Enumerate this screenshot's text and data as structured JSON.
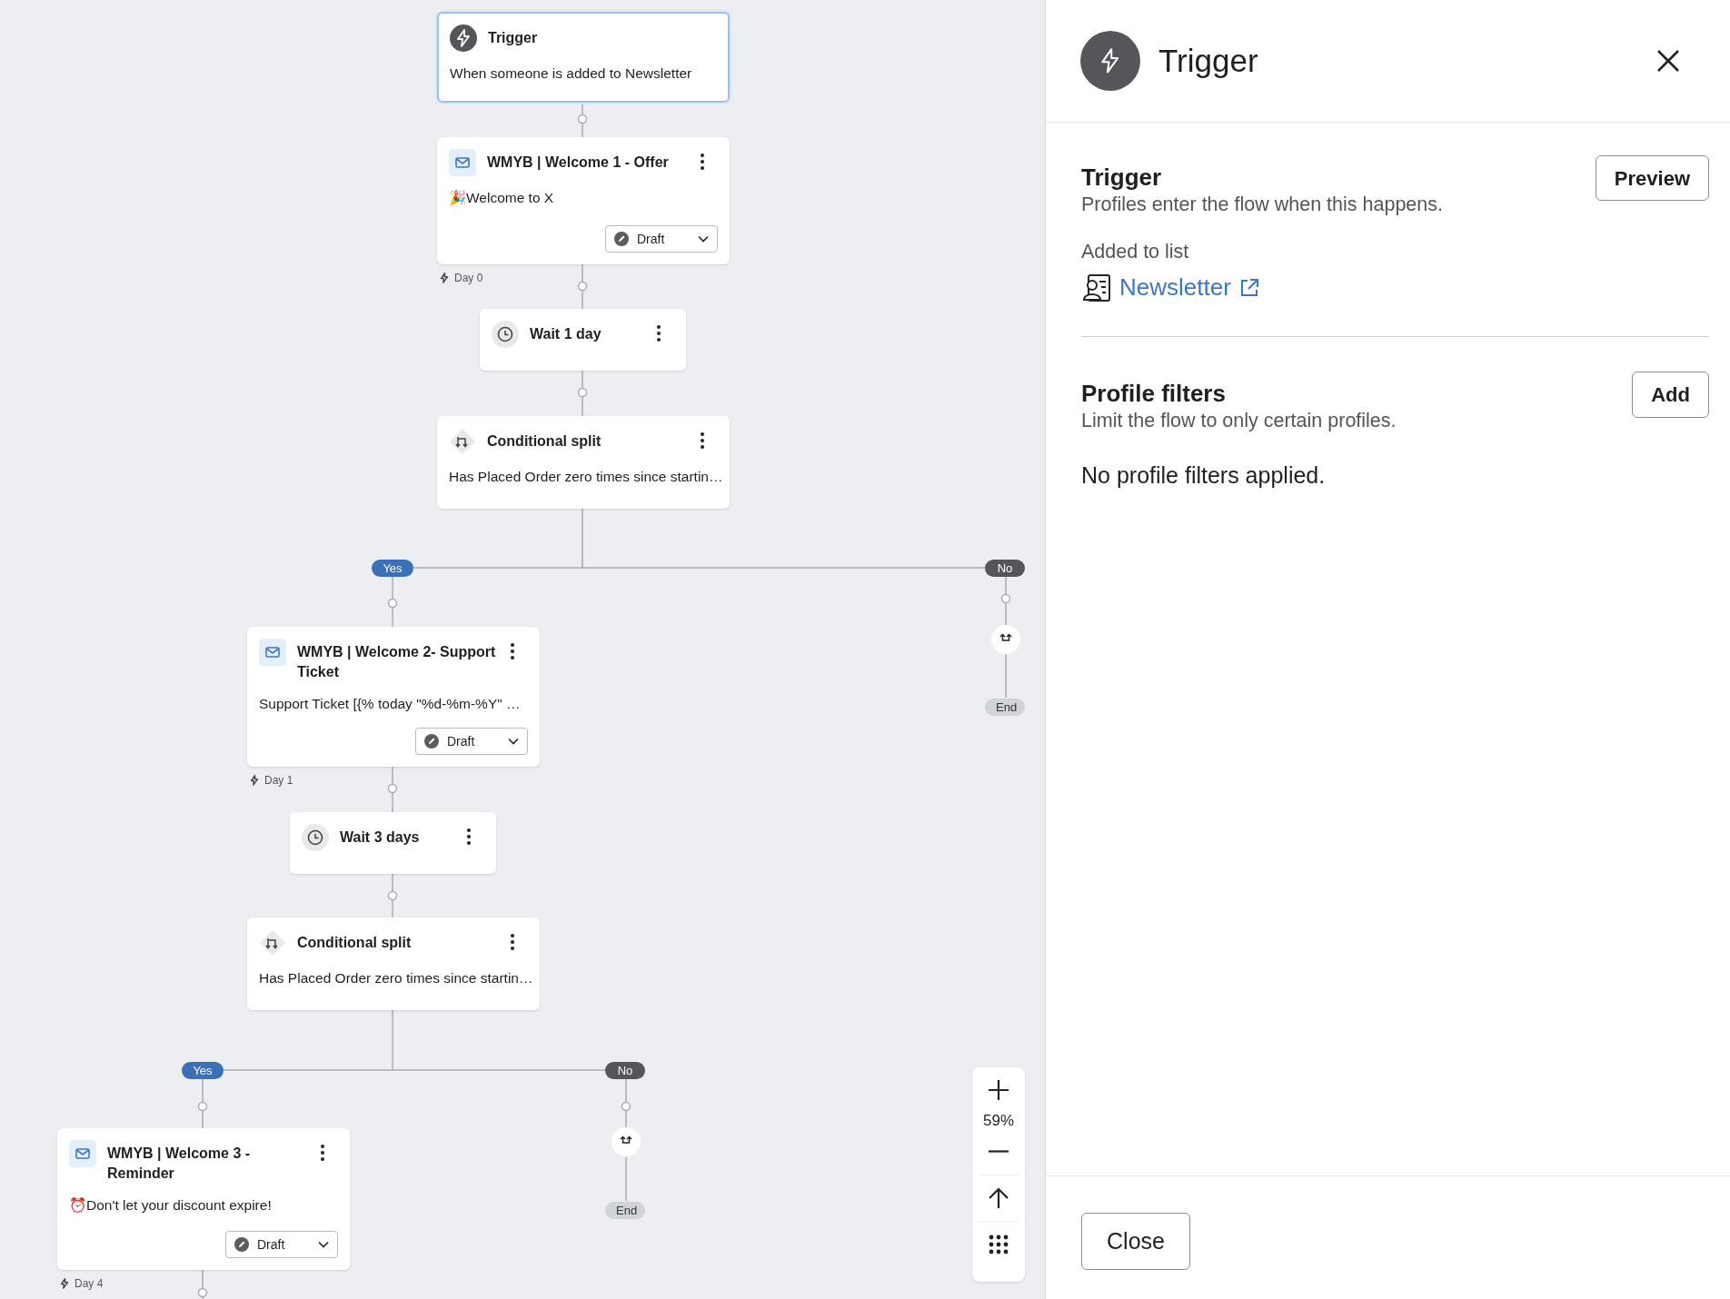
{
  "canvas": {
    "nodes": [
      {
        "kind": "trigger",
        "title": "Trigger",
        "text": "When someone is added to Newsletter",
        "selected": true
      },
      {
        "kind": "email",
        "title": "WMYB | Welcome 1 - Offer",
        "text": "🎉Welcome to X",
        "status": "Draft",
        "day": "Day 0",
        "selected": false
      },
      {
        "kind": "wait",
        "title": "Wait 1 day",
        "selected": false
      },
      {
        "kind": "split",
        "title": "Conditional split",
        "text": "Has Placed Order zero times since startin…",
        "selected": false
      },
      {
        "kind": "yes",
        "label": "Yes"
      },
      {
        "kind": "no",
        "label": "No"
      },
      {
        "kind": "end",
        "label": "End"
      },
      {
        "kind": "email",
        "title": "WMYB | Welcome 2- Support Ticket",
        "text": "Support Ticket [{% today \"%d-%m-%Y\" …",
        "status": "Draft",
        "day": "Day 1",
        "selected": false
      },
      {
        "kind": "wait",
        "title": "Wait 3 days",
        "selected": false
      },
      {
        "kind": "split",
        "title": "Conditional split",
        "text": "Has Placed Order zero times since startin…",
        "selected": false
      },
      {
        "kind": "yes",
        "label": "Yes"
      },
      {
        "kind": "no",
        "label": "No"
      },
      {
        "kind": "end",
        "label": "End"
      },
      {
        "kind": "email",
        "title": "WMYB | Welcome 3 - Reminder",
        "text": "⏰Don't let your discount expire!",
        "status": "Draft",
        "day": "Day 4",
        "selected": false
      }
    ],
    "zoom": {
      "level_text": "59%"
    }
  },
  "panel": {
    "title": "Trigger",
    "trigger_section": {
      "heading": "Trigger",
      "description": "Profiles enter the flow when this happens.",
      "button": "Preview",
      "field_label": "Added to list",
      "list_link": "Newsletter"
    },
    "filters_section": {
      "heading": "Profile filters",
      "description": "Limit the flow to only certain profiles.",
      "button": "Add",
      "empty_text": "No profile filters applied."
    },
    "footer_button": "Close"
  }
}
